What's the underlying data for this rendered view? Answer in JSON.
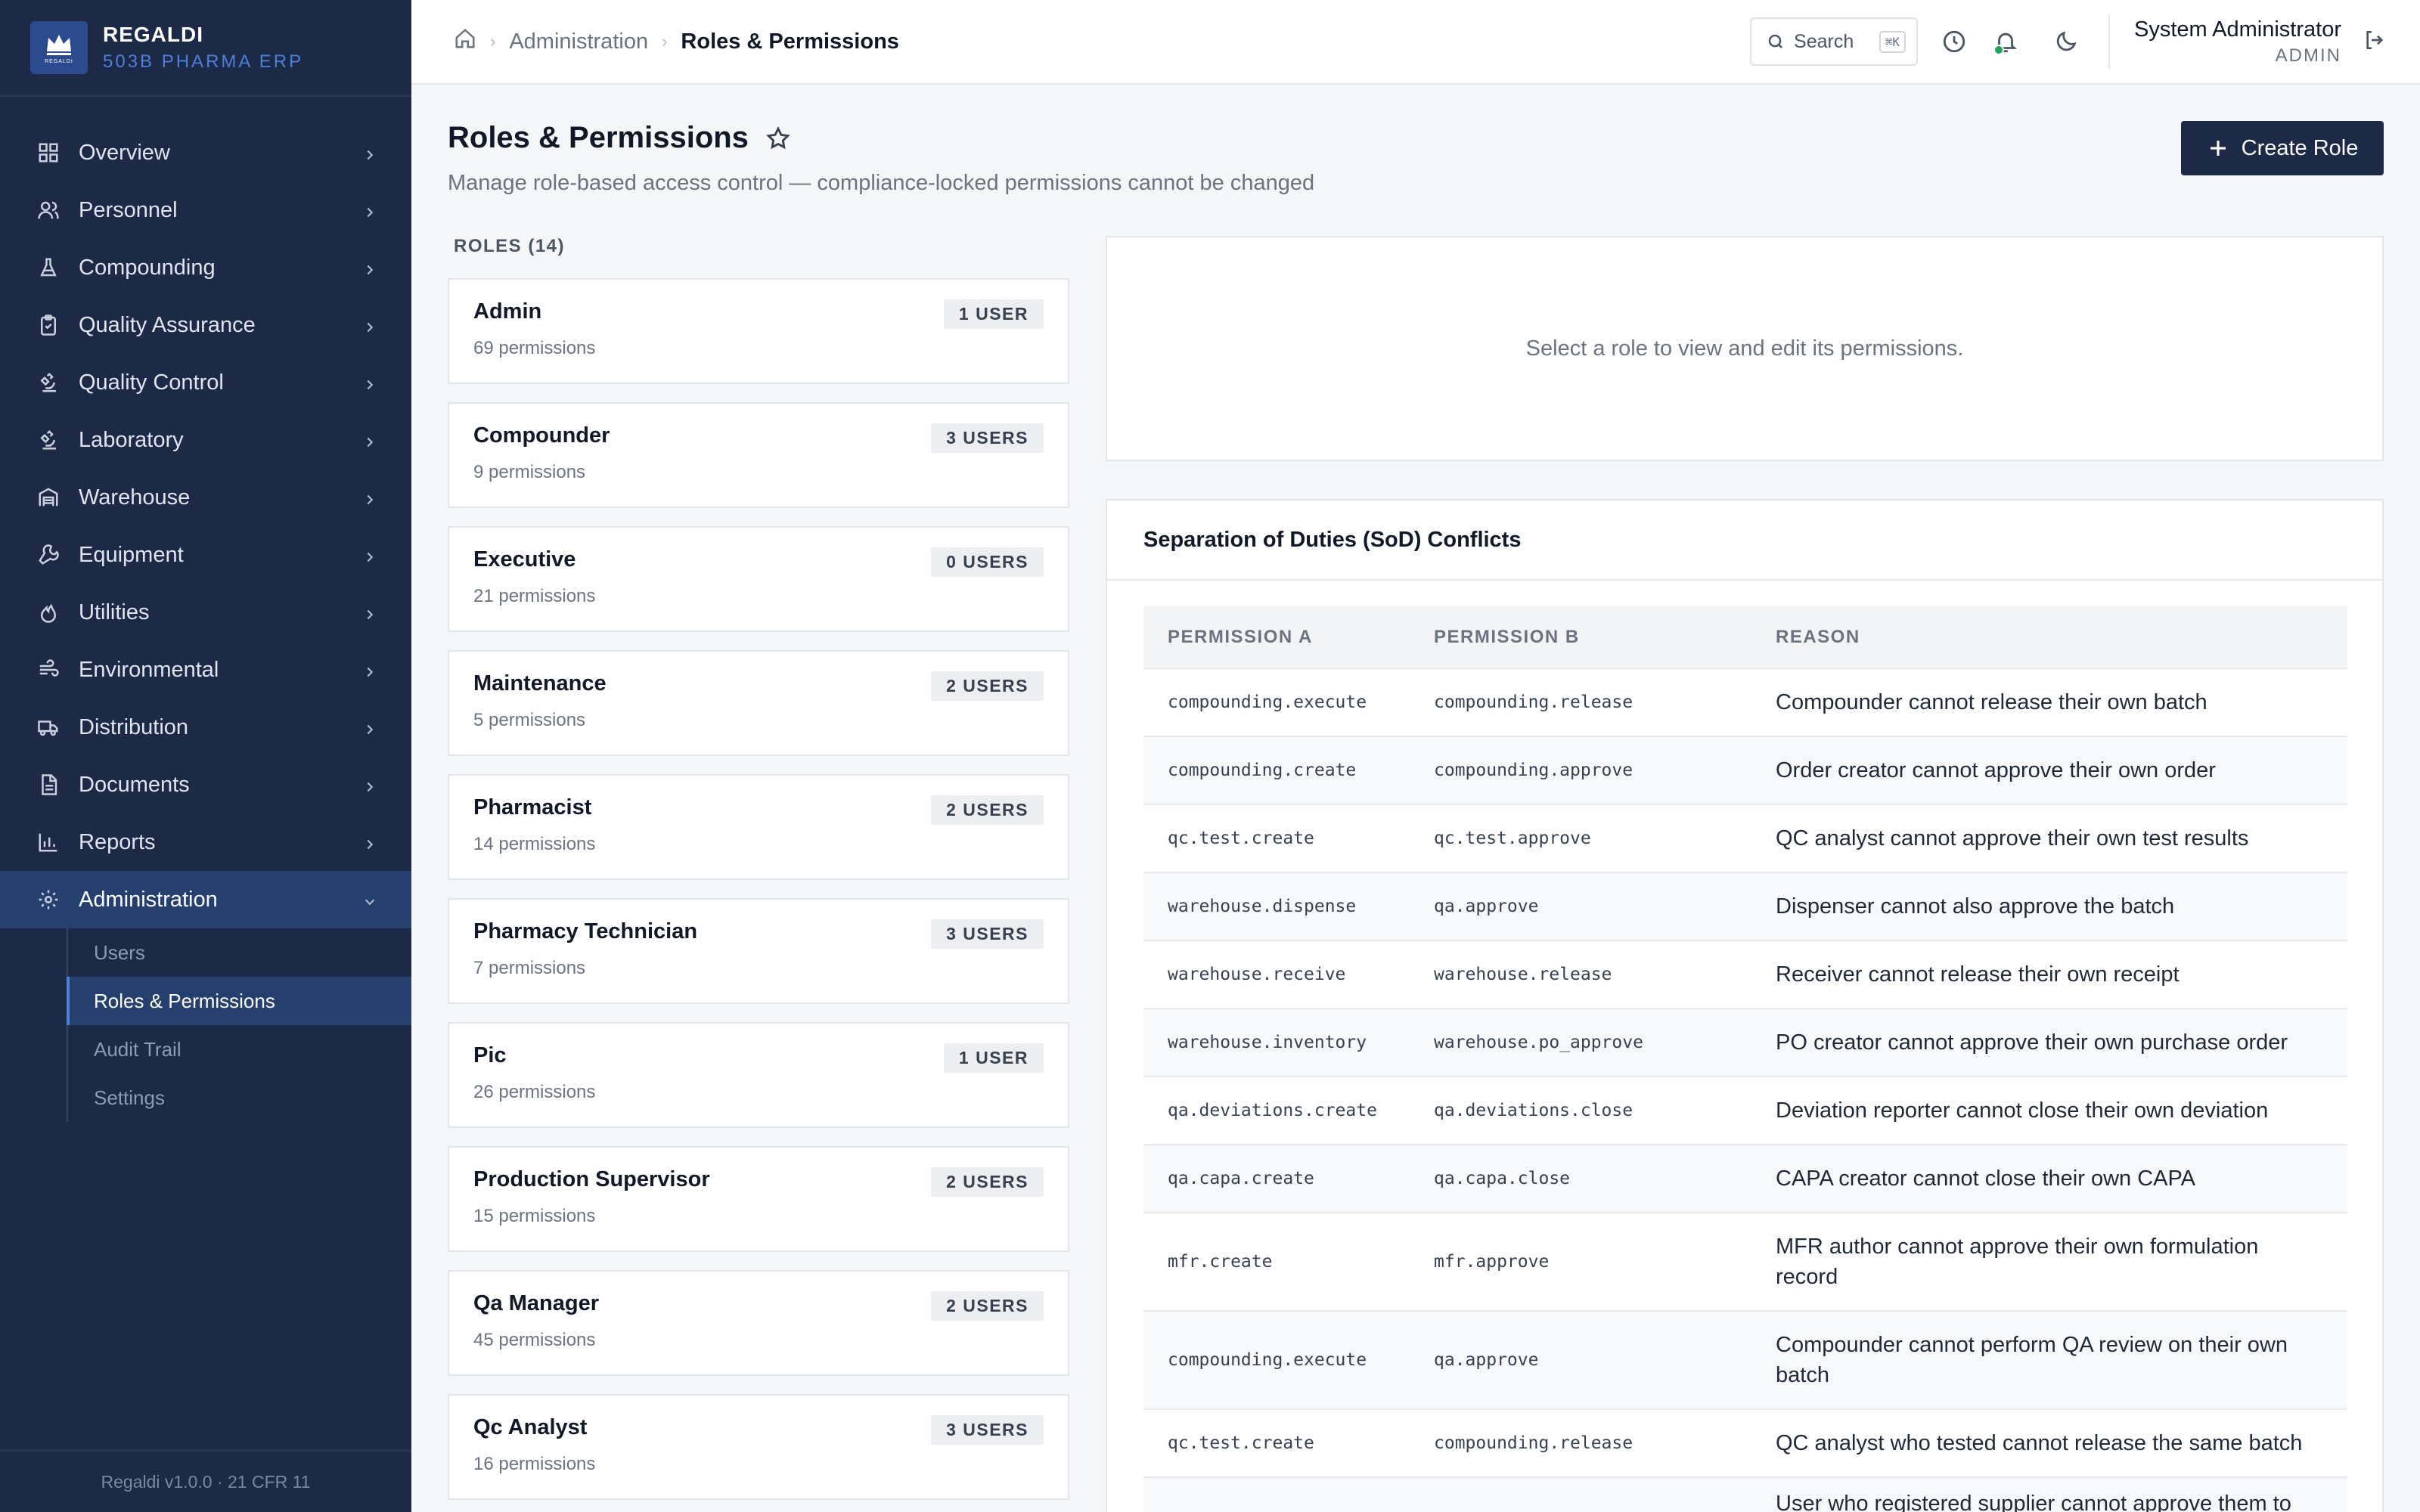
{
  "brand": {
    "name": "REGALDI",
    "subtitle": "503B PHARMA ERP",
    "logo_text": "REGALDI"
  },
  "nav": {
    "items": [
      {
        "label": "Overview",
        "icon": "grid-icon"
      },
      {
        "label": "Personnel",
        "icon": "users-icon"
      },
      {
        "label": "Compounding",
        "icon": "flask-icon"
      },
      {
        "label": "Quality Assurance",
        "icon": "clipboard-check-icon"
      },
      {
        "label": "Quality Control",
        "icon": "microscope-icon"
      },
      {
        "label": "Laboratory",
        "icon": "microscope-icon"
      },
      {
        "label": "Warehouse",
        "icon": "warehouse-icon"
      },
      {
        "label": "Equipment",
        "icon": "wrench-icon"
      },
      {
        "label": "Utilities",
        "icon": "flame-icon"
      },
      {
        "label": "Environmental",
        "icon": "wind-icon"
      },
      {
        "label": "Distribution",
        "icon": "truck-icon"
      },
      {
        "label": "Documents",
        "icon": "file-text-icon"
      },
      {
        "label": "Reports",
        "icon": "bar-chart-icon"
      },
      {
        "label": "Administration",
        "icon": "gear-icon"
      }
    ],
    "sub_items": [
      "Users",
      "Roles & Permissions",
      "Audit Trail",
      "Settings"
    ]
  },
  "footer": "Regaldi v1.0.0 · 21 CFR 11",
  "breadcrumb": {
    "parent": "Administration",
    "current": "Roles & Permissions"
  },
  "topbar": {
    "search_label": "Search",
    "search_kbd": "⌘K",
    "user_name": "System Administrator",
    "user_role": "ADMIN"
  },
  "page": {
    "title": "Roles & Permissions",
    "subtitle": "Manage role-based access control — compliance-locked permissions cannot be changed",
    "create_label": "Create Role"
  },
  "roles_heading": "ROLES (14)",
  "roles": [
    {
      "name": "Admin",
      "perms": "69 permissions",
      "users": "1 USER"
    },
    {
      "name": "Compounder",
      "perms": "9 permissions",
      "users": "3 USERS"
    },
    {
      "name": "Executive",
      "perms": "21 permissions",
      "users": "0 USERS"
    },
    {
      "name": "Maintenance",
      "perms": "5 permissions",
      "users": "2 USERS"
    },
    {
      "name": "Pharmacist",
      "perms": "14 permissions",
      "users": "2 USERS"
    },
    {
      "name": "Pharmacy Technician",
      "perms": "7 permissions",
      "users": "3 USERS"
    },
    {
      "name": "Pic",
      "perms": "26 permissions",
      "users": "1 USER"
    },
    {
      "name": "Production Supervisor",
      "perms": "15 permissions",
      "users": "2 USERS"
    },
    {
      "name": "Qa Manager",
      "perms": "45 permissions",
      "users": "2 USERS"
    },
    {
      "name": "Qc Analyst",
      "perms": "16 permissions",
      "users": "3 USERS"
    }
  ],
  "detail_placeholder": "Select a role to view and edit its permissions.",
  "sod": {
    "title": "Separation of Duties (SoD) Conflicts",
    "columns": [
      "PERMISSION A",
      "PERMISSION B",
      "REASON"
    ],
    "rows": [
      {
        "a": "compounding.execute",
        "b": "compounding.release",
        "reason": "Compounder cannot release their own batch"
      },
      {
        "a": "compounding.create",
        "b": "compounding.approve",
        "reason": "Order creator cannot approve their own order"
      },
      {
        "a": "qc.test.create",
        "b": "qc.test.approve",
        "reason": "QC analyst cannot approve their own test results"
      },
      {
        "a": "warehouse.dispense",
        "b": "qa.approve",
        "reason": "Dispenser cannot also approve the batch"
      },
      {
        "a": "warehouse.receive",
        "b": "warehouse.release",
        "reason": "Receiver cannot release their own receipt"
      },
      {
        "a": "warehouse.inventory",
        "b": "warehouse.po_approve",
        "reason": "PO creator cannot approve their own purchase order"
      },
      {
        "a": "qa.deviations.create",
        "b": "qa.deviations.close",
        "reason": "Deviation reporter cannot close their own deviation"
      },
      {
        "a": "qa.capa.create",
        "b": "qa.capa.close",
        "reason": "CAPA creator cannot close their own CAPA"
      },
      {
        "a": "mfr.create",
        "b": "mfr.approve",
        "reason": "MFR author cannot approve their own formulation record"
      },
      {
        "a": "compounding.execute",
        "b": "qa.approve",
        "reason": "Compounder cannot perform QA review on their own batch"
      },
      {
        "a": "qc.test.create",
        "b": "compounding.release",
        "reason": "QC analyst who tested cannot release the same batch"
      },
      {
        "a": "",
        "b": "",
        "reason": "User who registered supplier cannot approve them to"
      }
    ]
  },
  "colors": {
    "sidebar": "#1c2a48",
    "accent": "#4e7fd6",
    "primary_button": "#1c2a48",
    "status_dot": "#22a35a"
  }
}
